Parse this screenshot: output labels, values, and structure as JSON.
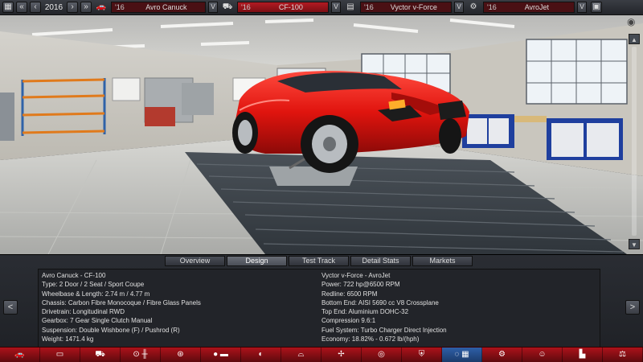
{
  "topbar": {
    "year": "2016",
    "fields": [
      {
        "year": "'16",
        "name": "Avro Canuck",
        "active": false
      },
      {
        "year": "'16",
        "name": "CF-100",
        "active": true
      },
      {
        "year": "'16",
        "name": "Vyctor v-Force",
        "active": false
      },
      {
        "year": "'16",
        "name": "AvroJet",
        "active": false
      }
    ]
  },
  "tabs": [
    "Overview",
    "Design",
    "Test Track",
    "Detail Stats",
    "Markets"
  ],
  "selected_tab": "Design",
  "specs_left": [
    "Avro Canuck - CF-100",
    "Type: 2 Door / 2 Seat / Sport Coupe",
    "Wheelbase & Length: 2.74 m / 4.77 m",
    "Chassis: Carbon Fibre Monocoque / Fibre Glass Panels",
    "Drivetrain: Longitudinal RWD",
    "Gearbox: 7 Gear Single Clutch Manual",
    "Suspension: Double Wishbone (F) / Pushrod (R)",
    "Weight: 1471.4 kg"
  ],
  "specs_right": [
    "Vyctor v-Force - AvroJet",
    "Power: 722 hp@6500 RPM",
    "Redline: 6500 RPM",
    "Bottom End: AISI 5690 cc V8 Crossplane",
    "Top End: Aluminium DOHC-32",
    "Compression 9.6:1",
    "Fuel System: Turbo Charger Direct Injection",
    "Economy: 18.82% - 0.672 lb/(hph)"
  ],
  "icons": {
    "calendar": "calendar-icon",
    "car": "car-icon",
    "engine": "engine-icon",
    "trim": "car-body-icon",
    "save": "save-icon"
  },
  "strip_icons": [
    "car-icon",
    "chassis-icon",
    "car-trim-icon",
    "gearbox-icon",
    "wheel-icon",
    "suspension-icon",
    "brake-icon",
    "body-icon",
    "fans-icon",
    "interior-icon",
    "safety-icon",
    "test-icon",
    "engine-icon",
    "designer-icon",
    "factory-icon",
    "market-icon"
  ],
  "colors": {
    "accent": "#b21a22",
    "selected": "#2e5fa8"
  }
}
